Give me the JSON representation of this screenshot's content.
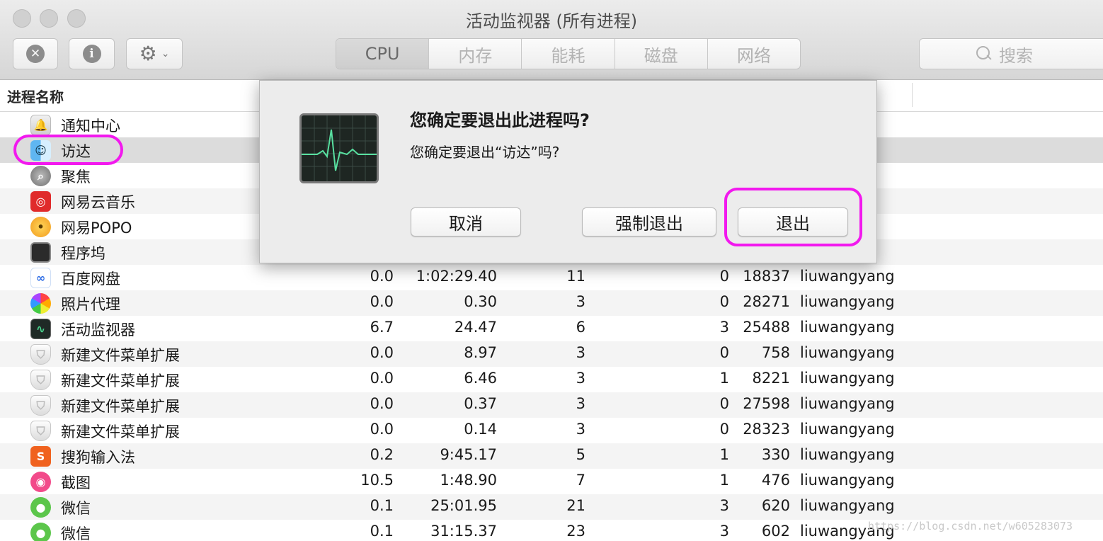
{
  "window": {
    "title": "活动监视器 (所有进程)"
  },
  "toolbar": {
    "stop_icon": "✕",
    "info_icon": "i",
    "gear_icon": "⚙",
    "chevron_icon": "⌄",
    "tabs": [
      {
        "label": "CPU",
        "active": true
      },
      {
        "label": "内存",
        "active": false
      },
      {
        "label": "能耗",
        "active": false
      },
      {
        "label": "磁盘",
        "active": false
      },
      {
        "label": "网络",
        "active": false
      }
    ],
    "search_placeholder": "搜索"
  },
  "table": {
    "column_process_name": "进程名称",
    "rows": [
      {
        "name": "通知中心",
        "icon": "notification-center-icon",
        "glyph": "🔔",
        "cpu": "",
        "time": "",
        "threads": "",
        "wakeups": "",
        "pid": "",
        "user": "ng"
      },
      {
        "name": "访达",
        "icon": "finder-icon",
        "glyph": "☺",
        "cpu": "",
        "time": "",
        "threads": "",
        "wakeups": "",
        "pid": "",
        "user": "ng"
      },
      {
        "name": "聚焦",
        "icon": "spotlight-icon",
        "glyph": "⌕",
        "cpu": "",
        "time": "",
        "threads": "",
        "wakeups": "",
        "pid": "",
        "user": "ng"
      },
      {
        "name": "网易云音乐",
        "icon": "netease-music-icon",
        "glyph": "◎",
        "cpu": "",
        "time": "",
        "threads": "",
        "wakeups": "",
        "pid": "",
        "user": "ng"
      },
      {
        "name": "网易POPO",
        "icon": "popo-icon",
        "glyph": "•",
        "cpu": "",
        "time": "",
        "threads": "",
        "wakeups": "",
        "pid": "",
        "user": "ng"
      },
      {
        "name": "程序坞",
        "icon": "dock-icon",
        "glyph": "",
        "cpu": "",
        "time": "",
        "threads": "",
        "wakeups": "",
        "pid": "",
        "user": "ng"
      },
      {
        "name": "百度网盘",
        "icon": "baidu-netdisk-icon",
        "glyph": "∞",
        "cpu": "0.0",
        "time": "1:02:29.40",
        "threads": "11",
        "wakeups": "0",
        "pid": "18837",
        "user": "liuwangyang"
      },
      {
        "name": "照片代理",
        "icon": "photos-agent-icon",
        "glyph": "",
        "cpu": "0.0",
        "time": "0.30",
        "threads": "3",
        "wakeups": "0",
        "pid": "28271",
        "user": "liuwangyang"
      },
      {
        "name": "活动监视器",
        "icon": "activity-monitor-icon",
        "glyph": "∿",
        "cpu": "6.7",
        "time": "24.47",
        "threads": "6",
        "wakeups": "3",
        "pid": "25488",
        "user": "liuwangyang"
      },
      {
        "name": "新建文件菜单扩展",
        "icon": "extension-icon",
        "glyph": "⛉",
        "cpu": "0.0",
        "time": "8.97",
        "threads": "3",
        "wakeups": "0",
        "pid": "758",
        "user": "liuwangyang"
      },
      {
        "name": "新建文件菜单扩展",
        "icon": "extension-icon",
        "glyph": "⛉",
        "cpu": "0.0",
        "time": "6.46",
        "threads": "3",
        "wakeups": "1",
        "pid": "8221",
        "user": "liuwangyang"
      },
      {
        "name": "新建文件菜单扩展",
        "icon": "extension-icon",
        "glyph": "⛉",
        "cpu": "0.0",
        "time": "0.37",
        "threads": "3",
        "wakeups": "0",
        "pid": "27598",
        "user": "liuwangyang"
      },
      {
        "name": "新建文件菜单扩展",
        "icon": "extension-icon",
        "glyph": "⛉",
        "cpu": "0.0",
        "time": "0.14",
        "threads": "3",
        "wakeups": "0",
        "pid": "28323",
        "user": "liuwangyang"
      },
      {
        "name": "搜狗输入法",
        "icon": "sogou-input-icon",
        "glyph": "S",
        "cpu": "0.2",
        "time": "9:45.17",
        "threads": "5",
        "wakeups": "1",
        "pid": "330",
        "user": "liuwangyang"
      },
      {
        "name": "截图",
        "icon": "screenshot-icon",
        "glyph": "◉",
        "cpu": "10.5",
        "time": "1:48.90",
        "threads": "7",
        "wakeups": "1",
        "pid": "476",
        "user": "liuwangyang"
      },
      {
        "name": "微信",
        "icon": "wechat-icon",
        "glyph": "●",
        "cpu": "0.1",
        "time": "25:01.95",
        "threads": "21",
        "wakeups": "3",
        "pid": "620",
        "user": "liuwangyang"
      },
      {
        "name": "微信",
        "icon": "wechat-icon",
        "glyph": "●",
        "cpu": "0.1",
        "time": "31:15.37",
        "threads": "23",
        "wakeups": "3",
        "pid": "602",
        "user": "liuwangyang"
      }
    ]
  },
  "dialog": {
    "title": "您确定要退出此进程吗?",
    "message": "您确定要退出“访达”吗?",
    "cancel_label": "取消",
    "force_quit_label": "强制退出",
    "quit_label": "退出"
  },
  "watermark": "https://blog.csdn.net/w605283073",
  "colors": {
    "highlight": "#f219ee"
  }
}
